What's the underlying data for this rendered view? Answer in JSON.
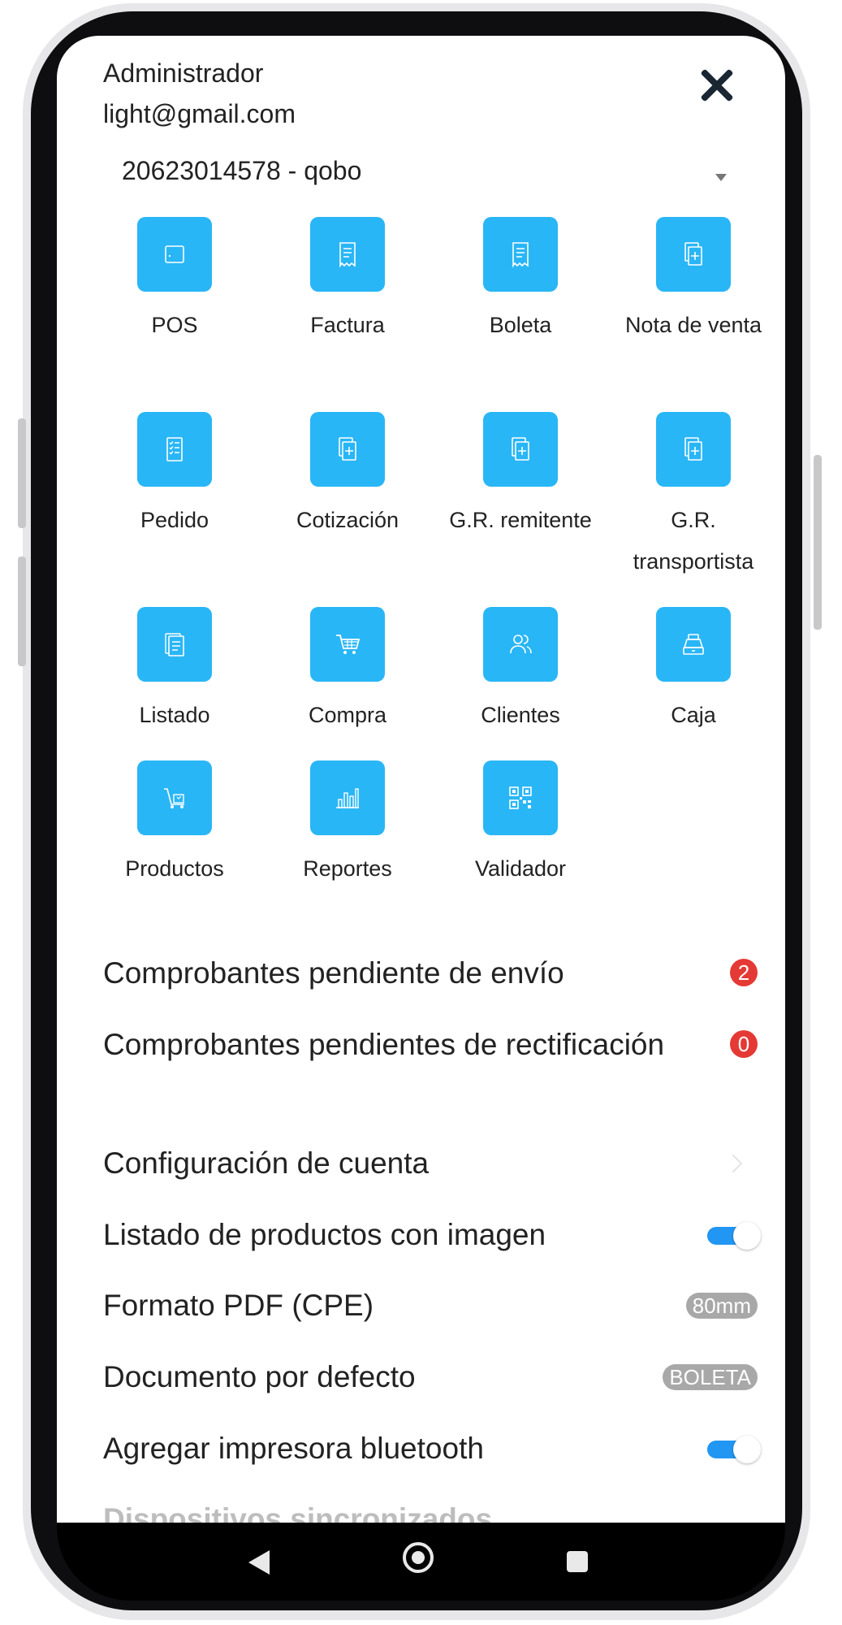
{
  "header": {
    "role": "Administrador",
    "email": "light@gmail.com",
    "company": "20623014578 - qobo"
  },
  "tiles": [
    {
      "label": "POS",
      "icon": "pos-icon"
    },
    {
      "label": "Factura",
      "icon": "invoice-icon"
    },
    {
      "label": "Boleta",
      "icon": "receipt-icon"
    },
    {
      "label": "Nota de venta",
      "icon": "sales-note-icon"
    },
    {
      "label": "Pedido",
      "icon": "order-icon"
    },
    {
      "label": "Cotización",
      "icon": "quote-icon"
    },
    {
      "label": "G.R. remitente",
      "icon": "sender-guide-icon"
    },
    {
      "label": "G.R. transportista",
      "icon": "carrier-guide-icon"
    },
    {
      "label": "Listado",
      "icon": "list-icon"
    },
    {
      "label": "Compra",
      "icon": "cart-icon"
    },
    {
      "label": "Clientes",
      "icon": "clients-icon"
    },
    {
      "label": "Caja",
      "icon": "cash-register-icon"
    },
    {
      "label": "Productos",
      "icon": "products-icon"
    },
    {
      "label": "Reportes",
      "icon": "reports-icon"
    },
    {
      "label": "Validador",
      "icon": "qr-validator-icon"
    }
  ],
  "pending": {
    "send_label": "Comprobantes pendiente de envío",
    "send_count": "2",
    "rectify_label": "Comprobantes pendientes de rectificación",
    "rectify_count": "0"
  },
  "settings": {
    "account_label": "Configuración de cuenta",
    "images_label": "Listado de productos con imagen",
    "images_on": true,
    "pdf_label": "Formato PDF (CPE)",
    "pdf_value": "80mm",
    "default_doc_label": "Documento por defecto",
    "default_doc_value": "BOLETA",
    "printer_label": "Agregar impresora bluetooth",
    "printer_on": true
  },
  "section_devices": "Dispositivos sincronizados",
  "colors": {
    "accent": "#29b6f6",
    "badge": "#e53935",
    "toggle": "#2196f3",
    "pill": "#a8a8a8"
  }
}
